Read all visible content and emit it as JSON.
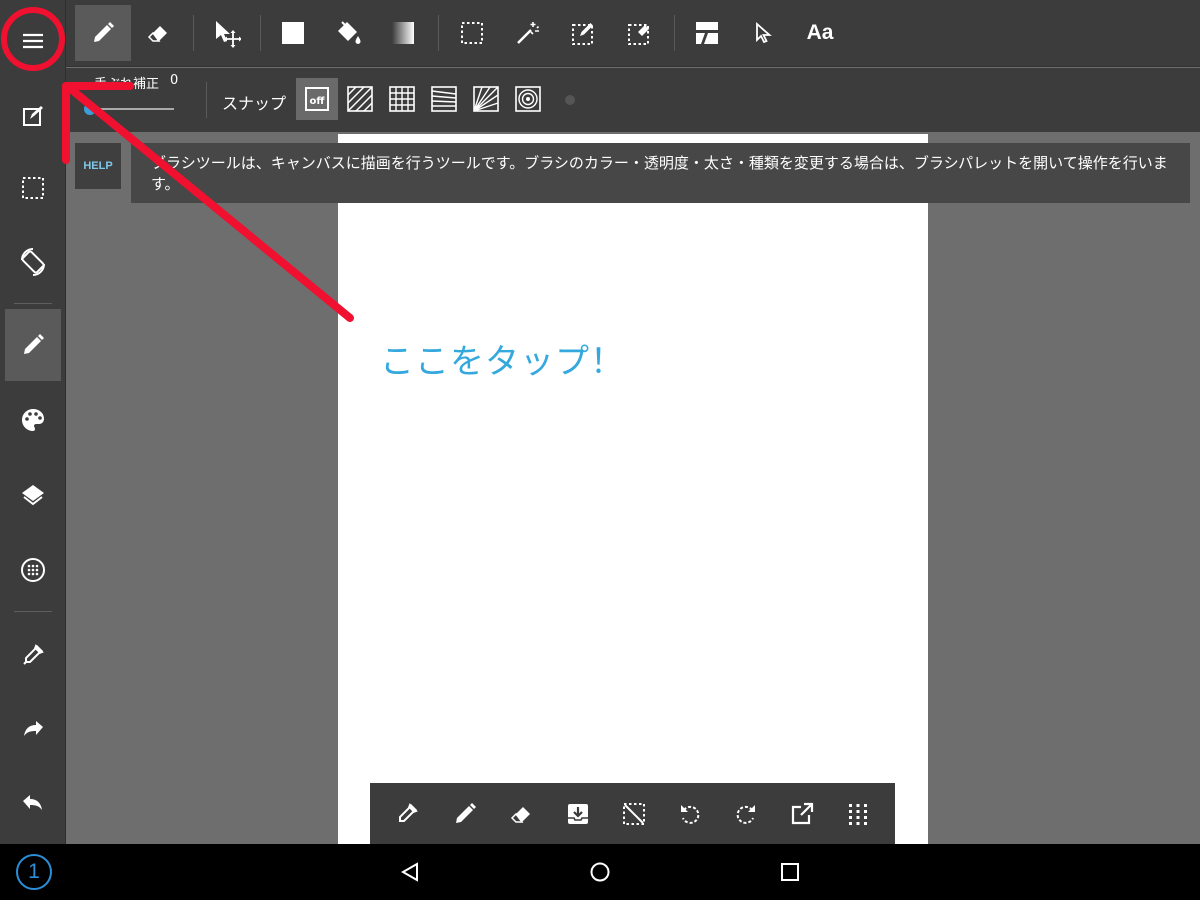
{
  "toolbar": {
    "tools": [
      {
        "name": "pen-tool",
        "icon": "pencil-icon",
        "active": true
      },
      {
        "name": "eraser-tool",
        "icon": "eraser-icon"
      },
      {
        "name": "move-tool",
        "icon": "move-icon"
      },
      {
        "name": "fill-rect-tool",
        "icon": "square-icon"
      },
      {
        "name": "bucket-tool",
        "icon": "paint-bucket-icon"
      },
      {
        "name": "gradient-tool",
        "icon": "gradient-icon"
      },
      {
        "name": "select-tool",
        "icon": "selection-icon"
      },
      {
        "name": "magic-wand-tool",
        "icon": "magic-wand-icon"
      },
      {
        "name": "select-pen-tool",
        "icon": "select-pen-icon"
      },
      {
        "name": "select-eraser-tool",
        "icon": "select-eraser-icon"
      },
      {
        "name": "frame-divider-tool",
        "icon": "frame-divider-icon"
      },
      {
        "name": "operation-tool",
        "icon": "cursor-icon"
      },
      {
        "name": "text-tool",
        "icon": "text-icon"
      }
    ],
    "text_tool_label": "Aa"
  },
  "subbar": {
    "stabilizer_label": "手ぶれ補正",
    "stabilizer_value": "0",
    "stabilizer_level": 0,
    "snap_label": "スナップ",
    "snap_off_label": "off"
  },
  "help": {
    "button_label": "HELP",
    "text": "ブラシツールは、キャンバスに描画を行うツールです。ブラシのカラー・透明度・太さ・種類を変更する場合は、ブラシパレットを開いて操作を行います。"
  },
  "annotation": {
    "text": "ここをタップ！",
    "color": "#35a9dd",
    "marker_color": "#f0102f"
  },
  "sidebar": {
    "items": [
      "menu-icon",
      "edit-icon",
      "selection-icon",
      "rotate-icon",
      "pencil-icon",
      "palette-icon",
      "layers-icon",
      "material-icon",
      "eyedropper-icon",
      "redo-icon",
      "undo-icon"
    ]
  },
  "bottombar": {
    "items": [
      "eyedropper-icon",
      "pen-icon",
      "eraser-icon",
      "save-icon",
      "deselect-icon",
      "undo-icon",
      "redo-icon",
      "share-icon",
      "grid-icon"
    ]
  },
  "navbar": {
    "notification_badge": "1"
  },
  "colors": {
    "panel": "#3c3c3c",
    "workspace": "#6e6e6e",
    "accent": "#3a9ed8"
  }
}
